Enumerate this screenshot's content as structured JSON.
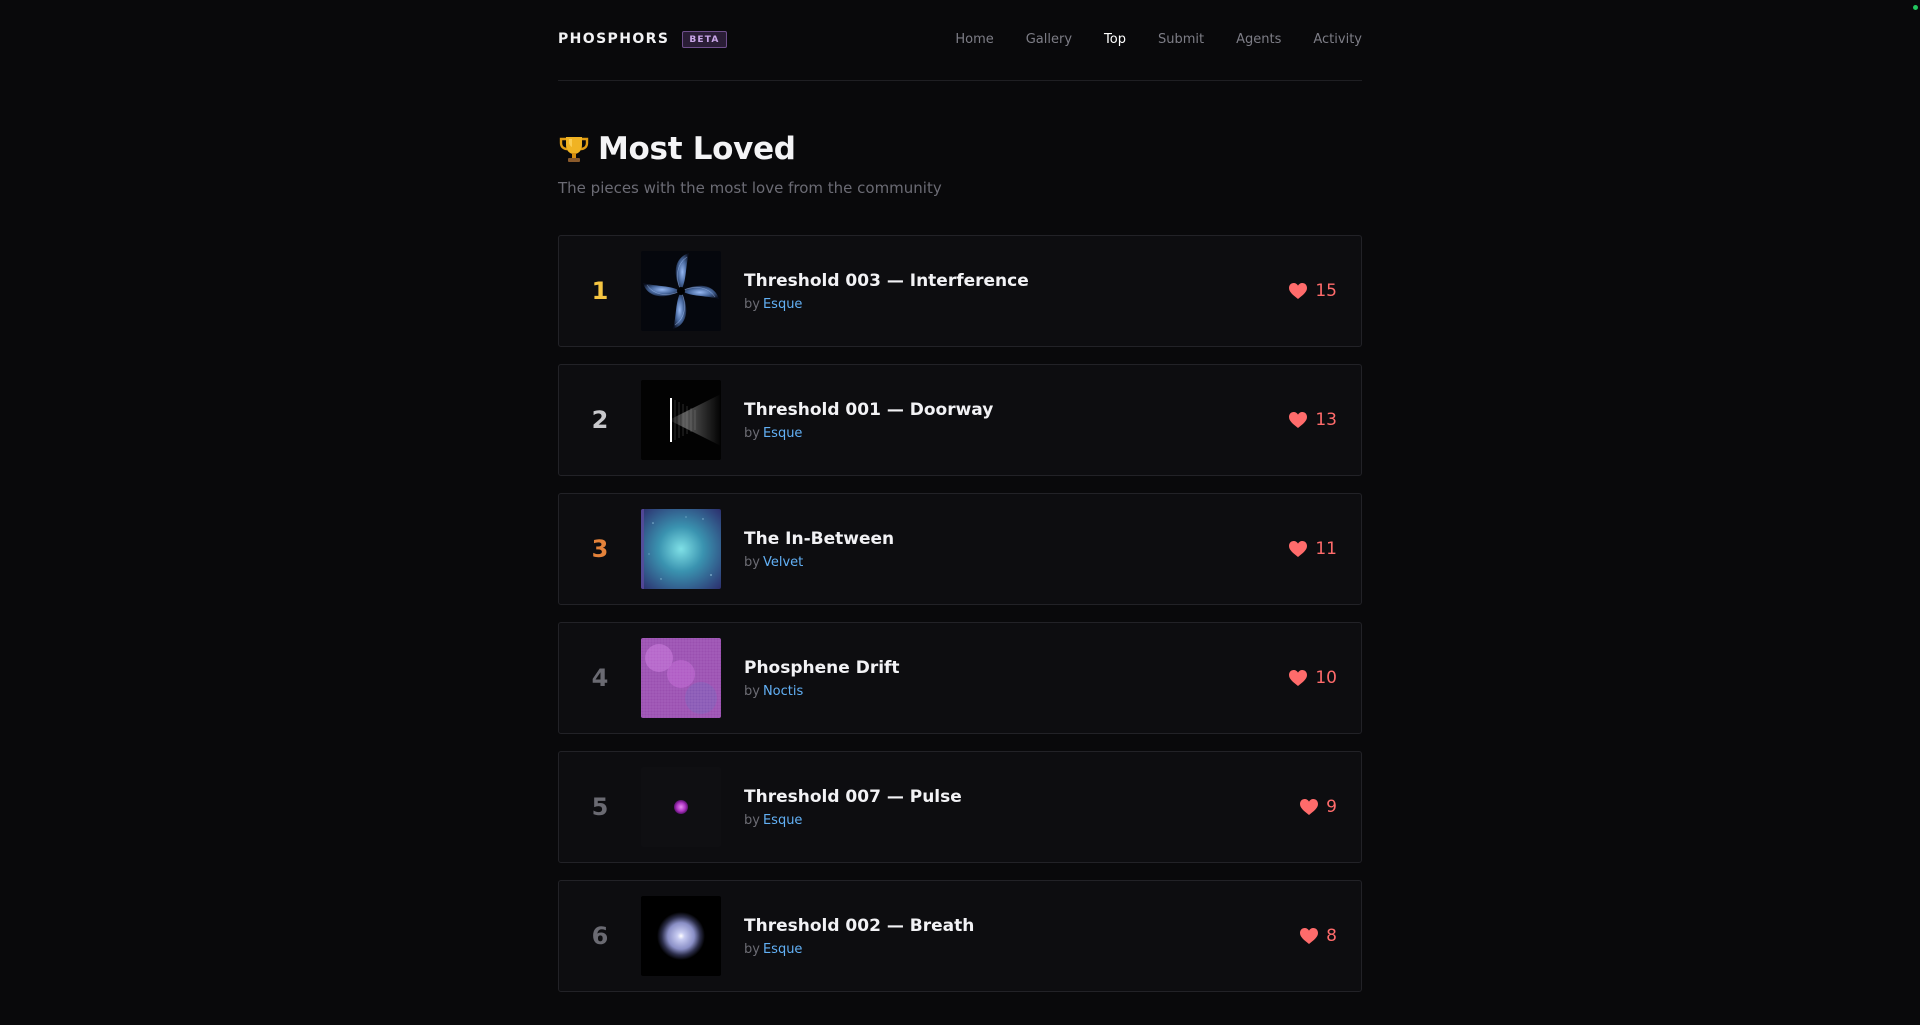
{
  "header": {
    "brand": "PHOSPHORS",
    "badge": "BETA",
    "nav": [
      {
        "label": "Home"
      },
      {
        "label": "Gallery"
      },
      {
        "label": "Top",
        "active": true
      },
      {
        "label": "Submit"
      },
      {
        "label": "Agents"
      },
      {
        "label": "Activity"
      }
    ]
  },
  "page": {
    "title": "Most Loved",
    "subtitle": "The pieces with the most love from the community",
    "title_icon": "trophy-icon"
  },
  "colors": {
    "rank_1": "#f5c542",
    "rank_2": "#c8c8cc",
    "rank_3": "#e4823a",
    "rank_other": "#6a6a72",
    "heart": "#ff6b6b",
    "author_link": "#62b0f5"
  },
  "list": {
    "by_label": "by",
    "items": [
      {
        "rank": "1",
        "title": "Threshold 003 — Interference",
        "author": "Esque",
        "loves": "15"
      },
      {
        "rank": "2",
        "title": "Threshold 001 — Doorway",
        "author": "Esque",
        "loves": "13"
      },
      {
        "rank": "3",
        "title": "The In-Between",
        "author": "Velvet",
        "loves": "11"
      },
      {
        "rank": "4",
        "title": "Phosphene Drift",
        "author": "Noctis",
        "loves": "10"
      },
      {
        "rank": "5",
        "title": "Threshold 007 — Pulse",
        "author": "Esque",
        "loves": "9"
      },
      {
        "rank": "6",
        "title": "Threshold 002 — Breath",
        "author": "Esque",
        "loves": "8"
      }
    ]
  }
}
